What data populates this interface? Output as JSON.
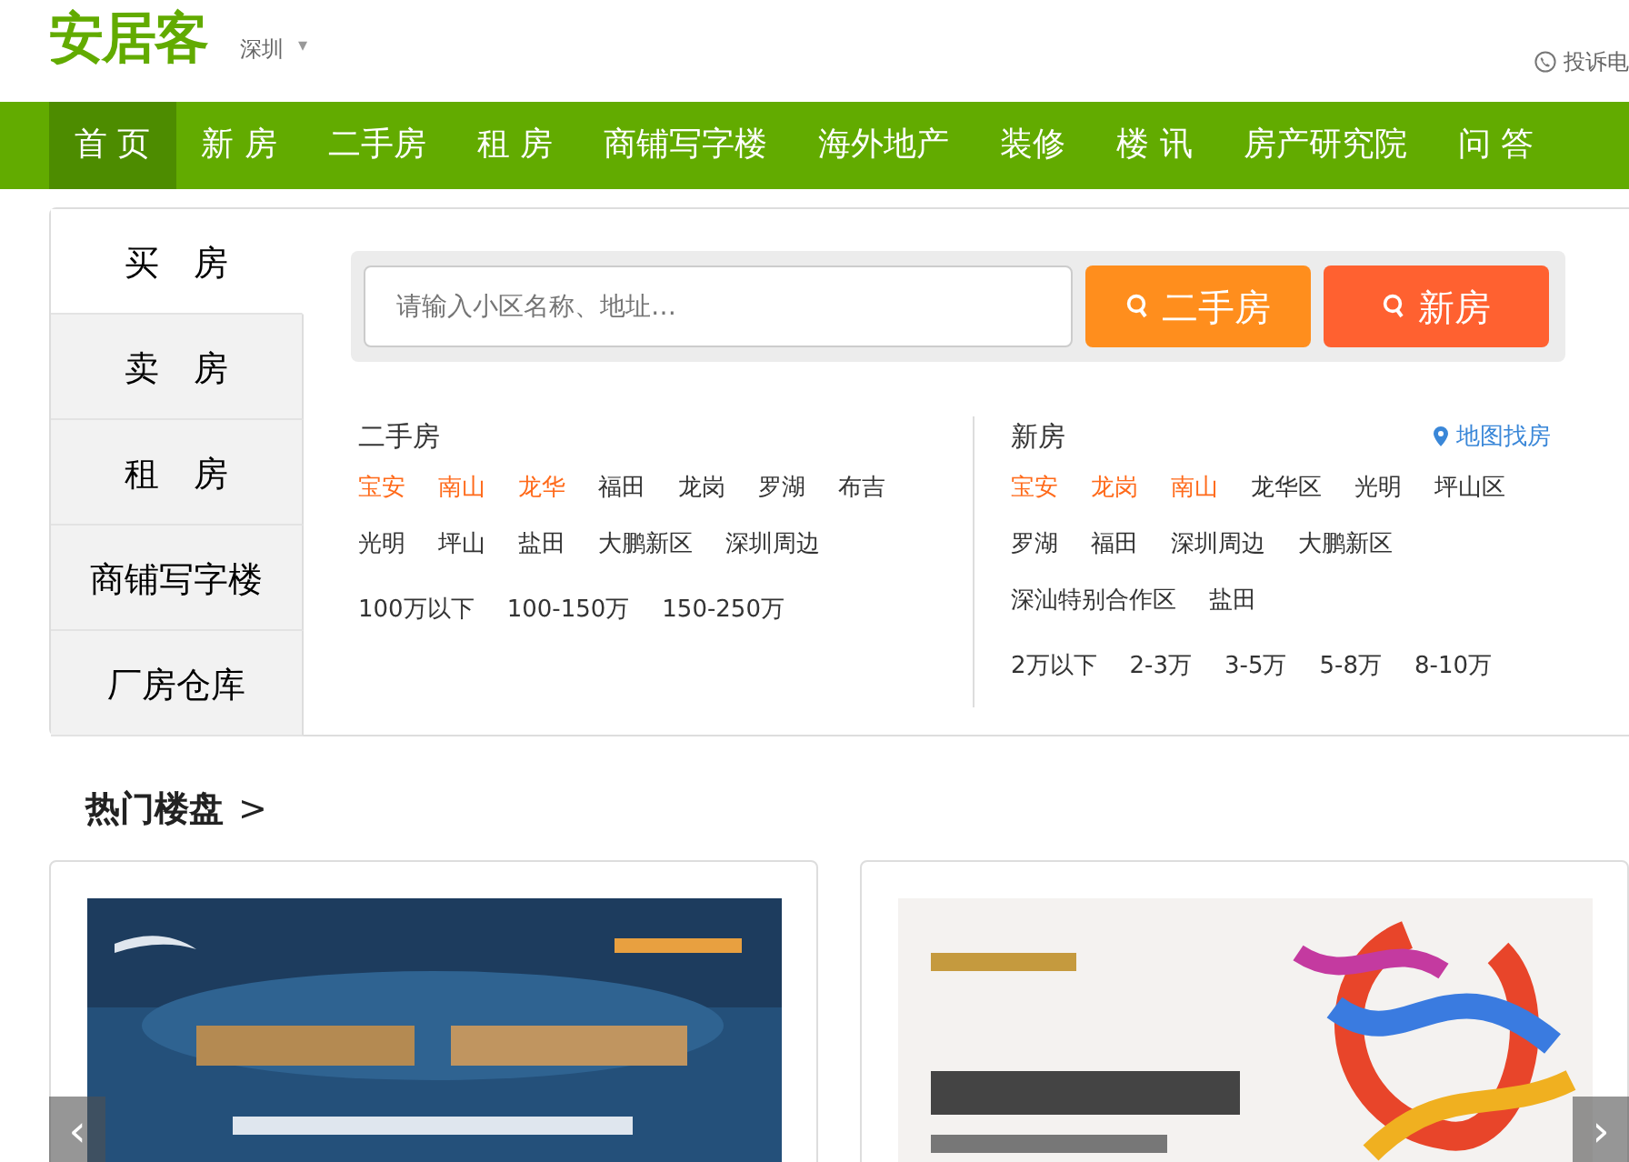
{
  "header": {
    "logo": "安居客",
    "city": "深圳",
    "city_caret": "▾",
    "complaint": "投诉电"
  },
  "nav": [
    {
      "label": "首 页",
      "selected": true
    },
    {
      "label": "新 房",
      "selected": false
    },
    {
      "label": "二手房",
      "selected": false
    },
    {
      "label": "租 房",
      "selected": false
    },
    {
      "label": "商铺写字楼",
      "selected": false
    },
    {
      "label": "海外地产",
      "selected": false
    },
    {
      "label": "装修",
      "selected": false
    },
    {
      "label": "楼 讯",
      "selected": false
    },
    {
      "label": "房产研究院",
      "selected": false
    },
    {
      "label": "问 答",
      "selected": false
    }
  ],
  "sidebar": [
    {
      "label": "买　房",
      "selected": true
    },
    {
      "label": "卖　房",
      "selected": false
    },
    {
      "label": "租　房",
      "selected": false
    },
    {
      "label": "商铺写字楼",
      "selected": false
    },
    {
      "label": "厂房仓库",
      "selected": false
    }
  ],
  "search": {
    "placeholder": "请输入小区名称、地址…",
    "buttons": [
      {
        "label": "二手房",
        "color": "#ff8e1d"
      },
      {
        "label": "新房",
        "color": "#ff6130"
      }
    ]
  },
  "sections": [
    {
      "title": "二手房",
      "districts": [
        {
          "label": "宝安",
          "hot": true
        },
        {
          "label": "南山",
          "hot": true
        },
        {
          "label": "龙华",
          "hot": true
        },
        {
          "label": "福田",
          "hot": false
        },
        {
          "label": "龙岗",
          "hot": false
        },
        {
          "label": "罗湖",
          "hot": false
        },
        {
          "label": "布吉",
          "hot": false
        },
        {
          "label": "光明",
          "hot": false
        },
        {
          "label": "坪山",
          "hot": false
        },
        {
          "label": "盐田",
          "hot": false
        },
        {
          "label": "大鹏新区",
          "hot": false
        },
        {
          "label": "深圳周边",
          "hot": false
        }
      ],
      "prices": [
        "100万以下",
        "100-150万",
        "150-250万"
      ]
    },
    {
      "title": "新房",
      "map_link": "地图找房",
      "districts": [
        {
          "label": "宝安",
          "hot": true
        },
        {
          "label": "龙岗",
          "hot": true
        },
        {
          "label": "南山",
          "hot": true
        },
        {
          "label": "龙华区",
          "hot": false
        },
        {
          "label": "光明",
          "hot": false
        },
        {
          "label": "坪山区",
          "hot": false
        },
        {
          "label": "罗湖",
          "hot": false
        },
        {
          "label": "福田",
          "hot": false
        },
        {
          "label": "深圳周边",
          "hot": false
        },
        {
          "label": "大鹏新区",
          "hot": false
        },
        {
          "label": "深汕特别合作区",
          "hot": false
        },
        {
          "label": "盐田",
          "hot": false
        }
      ],
      "prices": [
        "2万以下",
        "2-3万",
        "3-5万",
        "5-8万",
        "8-10万"
      ]
    }
  ],
  "hot": {
    "title": "热门楼盘",
    "arrow": ">",
    "prev": "‹",
    "next": "›"
  }
}
